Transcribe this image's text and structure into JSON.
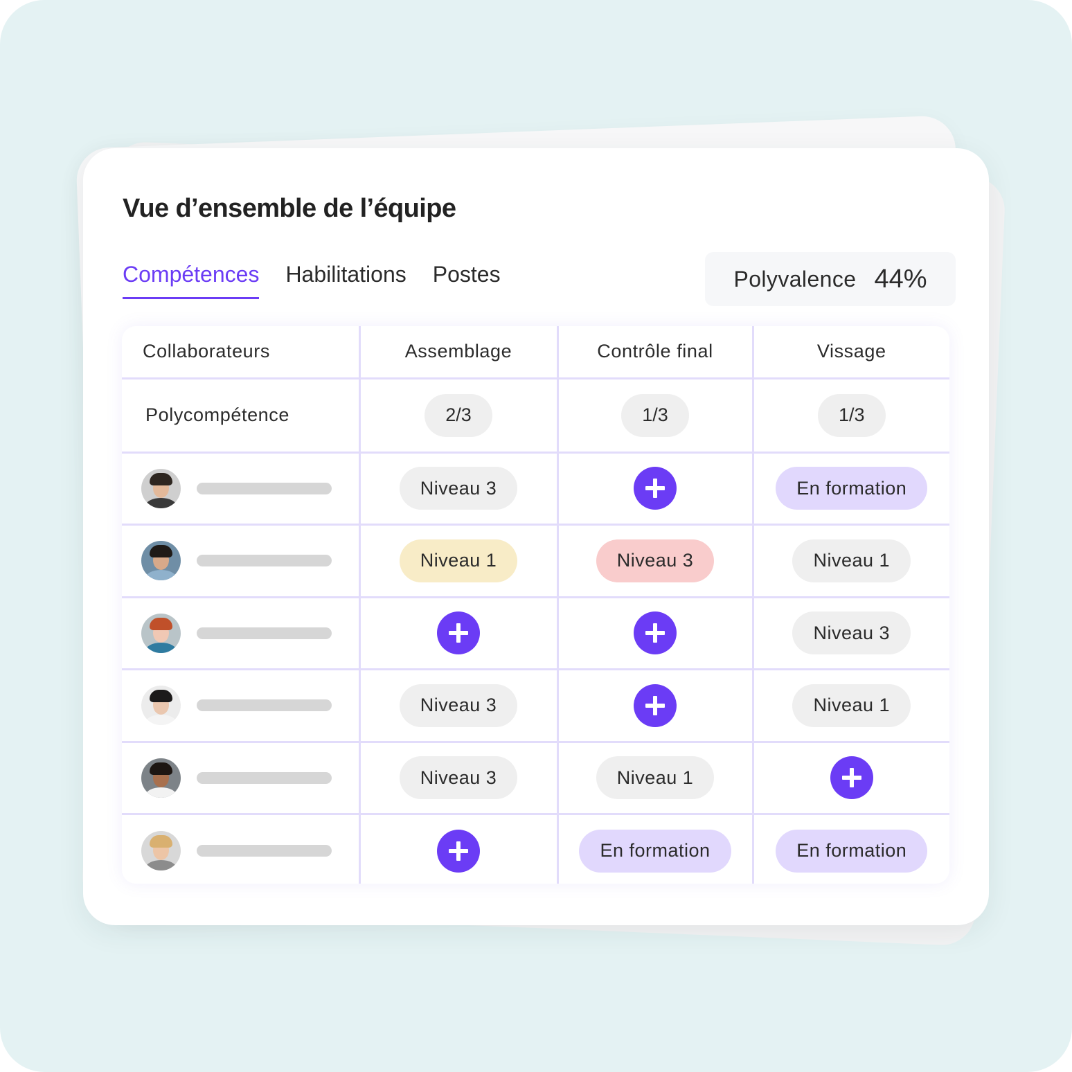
{
  "title": "Vue d’ensemble de l’équipe",
  "tabs": [
    {
      "label": "Compétences",
      "active": true
    },
    {
      "label": "Habilitations",
      "active": false
    },
    {
      "label": "Postes",
      "active": false
    }
  ],
  "polyvalence": {
    "label": "Polyvalence",
    "value": "44%"
  },
  "colors": {
    "accent": "#6b3cf5",
    "background": "#e4f2f3",
    "grid_line": "#e2dcfb",
    "pill_gray": "#efefef",
    "pill_yellow": "#f8ecc7",
    "pill_red": "#f9cccc",
    "pill_purple": "#e1d8fd"
  },
  "table": {
    "columns": [
      "Collaborateurs",
      "Assemblage",
      "Contrôle final",
      "Vissage"
    ],
    "polycompetence": {
      "label": "Polycompétence",
      "values": [
        "2/3",
        "1/3",
        "1/3"
      ]
    },
    "rows": [
      {
        "avatar": "avatar-young-man-hat",
        "cells": [
          {
            "type": "pill",
            "label": "Niveau 3",
            "variant": "gray"
          },
          {
            "type": "add",
            "icon": "plus-icon"
          },
          {
            "type": "pill",
            "label": "En formation",
            "variant": "purple"
          }
        ]
      },
      {
        "avatar": "avatar-man-dark-hair",
        "cells": [
          {
            "type": "pill",
            "label": "Niveau 1",
            "variant": "yellow"
          },
          {
            "type": "pill",
            "label": "Niveau 3",
            "variant": "red"
          },
          {
            "type": "pill",
            "label": "Niveau 1",
            "variant": "gray"
          }
        ]
      },
      {
        "avatar": "avatar-woman-red-hair",
        "cells": [
          {
            "type": "add",
            "icon": "plus-icon"
          },
          {
            "type": "add",
            "icon": "plus-icon"
          },
          {
            "type": "pill",
            "label": "Niveau 3",
            "variant": "gray"
          }
        ]
      },
      {
        "avatar": "avatar-woman-hair-bun",
        "cells": [
          {
            "type": "pill",
            "label": "Niveau 3",
            "variant": "gray"
          },
          {
            "type": "add",
            "icon": "plus-icon"
          },
          {
            "type": "pill",
            "label": "Niveau 1",
            "variant": "gray"
          }
        ]
      },
      {
        "avatar": "avatar-man-smiling",
        "cells": [
          {
            "type": "pill",
            "label": "Niveau 3",
            "variant": "gray"
          },
          {
            "type": "pill",
            "label": "Niveau 1",
            "variant": "gray"
          },
          {
            "type": "add",
            "icon": "plus-icon"
          }
        ]
      },
      {
        "avatar": "avatar-woman-blonde",
        "cells": [
          {
            "type": "add",
            "icon": "plus-icon"
          },
          {
            "type": "pill",
            "label": "En formation",
            "variant": "purple"
          },
          {
            "type": "pill",
            "label": "En formation",
            "variant": "purple"
          }
        ]
      }
    ]
  }
}
